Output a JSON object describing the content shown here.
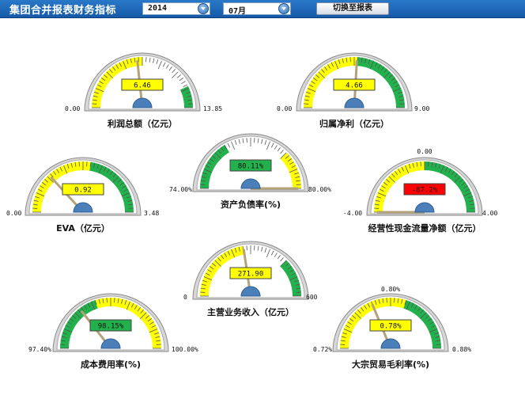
{
  "header": {
    "title": "集团合并报表财务指标",
    "year": "2014",
    "month": "07月",
    "switch_label": "切换至报表"
  },
  "colors": {
    "bar": "#1f6fc6",
    "green": "#22b14c",
    "yellow": "#ffff00",
    "red": "#ff0000",
    "needle": "#b3a27a",
    "hub": "#4a7fba"
  },
  "gauges": [
    {
      "label": "利润总额（亿元）",
      "min": "0.00",
      "max": "13.85",
      "value": "6.46",
      "min_n": 0,
      "max_n": 13.85,
      "value_n": 6.46,
      "display_color": "yellow",
      "zones": [
        {
          "from": 0,
          "to": 0.5,
          "color": "yellow"
        },
        {
          "from": 0.5,
          "to": 0.86,
          "color": "white"
        },
        {
          "from": 0.86,
          "to": 1,
          "color": "green"
        }
      ]
    },
    {
      "label": "归属净利（亿元）",
      "min": "0.00",
      "max": "9.00",
      "value": "4.66",
      "min_n": 0,
      "max_n": 9,
      "value_n": 4.66,
      "display_color": "yellow",
      "zones": [
        {
          "from": 0,
          "to": 0.52,
          "color": "yellow"
        },
        {
          "from": 0.52,
          "to": 1,
          "color": "green"
        }
      ]
    },
    {
      "label": "资产负债率(%)",
      "min": "74.00%",
      "max": "80.00%",
      "value": "80.11%",
      "min_n": 74,
      "max_n": 80,
      "value_n": 80.11,
      "display_color": "green",
      "zones": [
        {
          "from": 0,
          "to": 0.33,
          "color": "green"
        },
        {
          "from": 0.33,
          "to": 0.75,
          "color": "white"
        },
        {
          "from": 0.75,
          "to": 1,
          "color": "yellow"
        }
      ]
    },
    {
      "label": "EVA（亿元）",
      "min": "0.00",
      "max": "3.48",
      "value": "0.92",
      "min_n": 0,
      "max_n": 3.48,
      "value_n": 0.92,
      "display_color": "yellow",
      "zones": [
        {
          "from": 0,
          "to": 0.55,
          "color": "yellow"
        },
        {
          "from": 0.55,
          "to": 1,
          "color": "green"
        }
      ]
    },
    {
      "label": "经营性现金流量净额（亿元）",
      "min": "-4.00",
      "max": "4.00",
      "mid": "0.00",
      "value": "-87.2%",
      "min_n": -4,
      "max_n": 4,
      "value_n": -4,
      "display_color": "red",
      "zones": [
        {
          "from": 0,
          "to": 0.5,
          "color": "yellow"
        },
        {
          "from": 0.5,
          "to": 1,
          "color": "green"
        }
      ]
    },
    {
      "label": "主营业务收入（亿元）",
      "min": "0",
      "max": "600",
      "value": "271.90",
      "min_n": 0,
      "max_n": 600,
      "value_n": 271.9,
      "display_color": "yellow",
      "zones": [
        {
          "from": 0,
          "to": 0.45,
          "color": "yellow"
        },
        {
          "from": 0.45,
          "to": 0.75,
          "color": "white"
        },
        {
          "from": 0.75,
          "to": 1,
          "color": "green"
        }
      ]
    },
    {
      "label": "成本费用率(%)",
      "min": "97.40%",
      "max": "100.00%",
      "value": "98.15%",
      "min_n": 97.4,
      "max_n": 100,
      "value_n": 98.15,
      "display_color": "green",
      "zones": [
        {
          "from": 0,
          "to": 0.4,
          "color": "green"
        },
        {
          "from": 0.4,
          "to": 1,
          "color": "yellow"
        }
      ]
    },
    {
      "label": "大宗贸易毛利率(%)",
      "min": "0.72%",
      "max": "0.88%",
      "mid": "0.80%",
      "value": "0.78%",
      "min_n": 0.72,
      "max_n": 0.88,
      "value_n": 0.78,
      "display_color": "yellow",
      "zones": [
        {
          "from": 0,
          "to": 0.6,
          "color": "yellow"
        },
        {
          "from": 0.6,
          "to": 1,
          "color": "green"
        }
      ]
    }
  ]
}
